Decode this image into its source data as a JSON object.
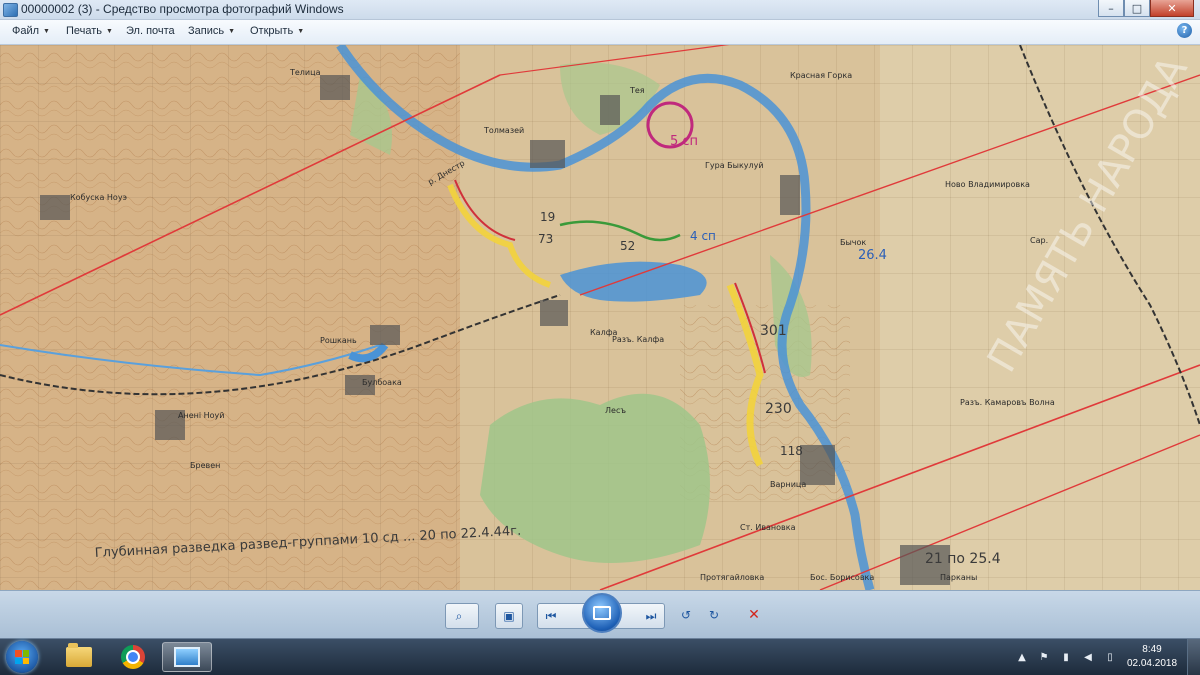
{
  "window": {
    "title": "00000002 (3) - Средство просмотра фотографий Windows",
    "minimize": "–",
    "maximize": "□",
    "close": "✕"
  },
  "menu": {
    "items": [
      {
        "label": "Файл",
        "has_arrow": true
      },
      {
        "label": "Печать",
        "has_arrow": true
      },
      {
        "label": "Эл. почта",
        "has_arrow": false
      },
      {
        "label": "Запись",
        "has_arrow": true
      },
      {
        "label": "Открыть",
        "has_arrow": true
      }
    ],
    "help": "?"
  },
  "map": {
    "labels": [
      "Телица",
      "Толмазей",
      "Тея",
      "Красная Горка",
      "Гура Быкулуй",
      "Ново Владимировка",
      "Кобуска Ноуэ",
      "Рошкань",
      "Булбоака",
      "Аненi Ноуй",
      "Калфа",
      "Варница",
      "Бычок",
      "Парканы",
      "р. Днестр",
      "Бревен",
      "Протягайловка",
      "Ст. Ивановка",
      "Разъ. Калфа",
      "Разъ. Камаровъ Волна",
      "Лесъ",
      "Бос. Борисовка",
      "Сар."
    ],
    "annotations": [
      "73",
      "19",
      "52",
      "301",
      "230",
      "118",
      "26.4",
      "5 сп",
      "4 сп",
      "21 по 25.4",
      "Глубинная разведка развед-группами 10 сд ... 20 по 22.4.44г."
    ],
    "watermark": "ПАМЯТЬ НАРОДА"
  },
  "toolbar": {
    "zoom_icon": "magnifier-icon",
    "fit_icon": "fit-icon",
    "prev_icon": "prev-icon",
    "slideshow_icon": "slideshow-icon",
    "next_icon": "next-icon",
    "rotate_ccw_icon": "rotate-ccw-icon",
    "rotate_cw_icon": "rotate-cw-icon",
    "delete_icon": "delete-icon"
  },
  "taskbar": {
    "apps": [
      "explorer-icon",
      "chrome-icon",
      "photo-viewer-icon"
    ],
    "time": "8:49",
    "date": "02.04.2018"
  },
  "colors": {
    "titlebar": "#d6e2ef",
    "map_paper": "#d8bf95",
    "river": "#4a93d6",
    "red_line": "#e03a3a",
    "taskbar": "#1d2b3b"
  }
}
